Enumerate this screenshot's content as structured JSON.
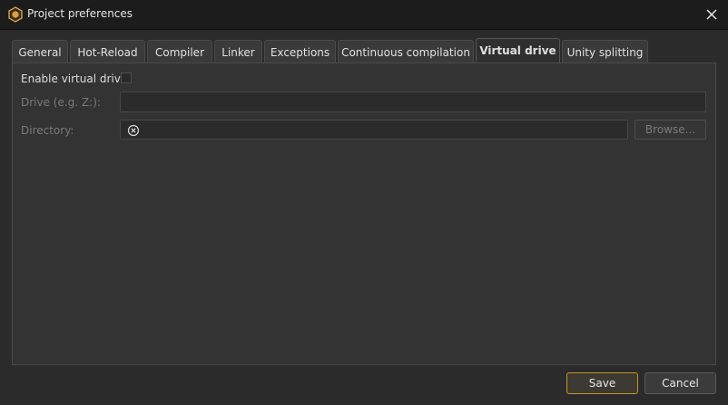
{
  "window": {
    "title": "Project preferences"
  },
  "icons": {
    "app": "app-logo-icon",
    "close": "close-icon",
    "clear": "clear-icon"
  },
  "tabs": [
    {
      "label": "General"
    },
    {
      "label": "Hot-Reload"
    },
    {
      "label": "Compiler"
    },
    {
      "label": "Linker"
    },
    {
      "label": "Exceptions"
    },
    {
      "label": "Continuous compilation"
    },
    {
      "label": "Virtual drive",
      "active": true
    },
    {
      "label": "Unity splitting"
    }
  ],
  "form": {
    "enable_label": "Enable virtual drive:",
    "enable_checked": false,
    "drive_label": "Drive (e.g. Z:):",
    "drive_value": "",
    "directory_label": "Directory:",
    "directory_value": "",
    "browse_label": "Browse..."
  },
  "footer": {
    "save_label": "Save",
    "cancel_label": "Cancel"
  },
  "colors": {
    "accent": "#c8922a",
    "background": "#2b2b2b",
    "panel": "#333333",
    "disabled_text": "#7a7a7a"
  }
}
